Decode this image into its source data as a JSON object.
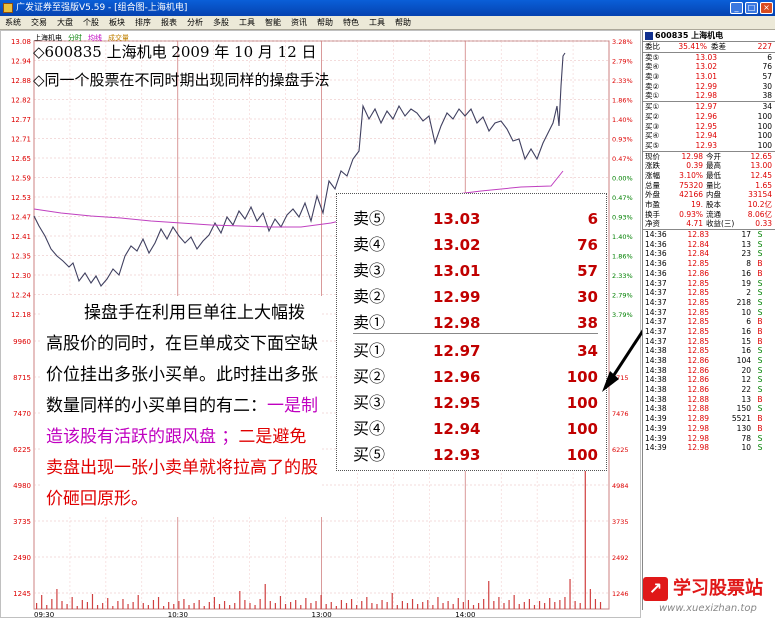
{
  "window": {
    "title": "广发证券至强版V5.59 - [组合图-上海机电]"
  },
  "menu": [
    "系统",
    "交易",
    "大盘",
    "个股",
    "板块",
    "排序",
    "报表",
    "分析",
    "多股",
    "工具",
    "智能",
    "资讯",
    "帮助",
    "特色",
    "工具",
    "帮助"
  ],
  "chart": {
    "tabs": [
      "上海机电",
      "分时",
      "均线",
      "成交量"
    ],
    "price_labels": [
      "13.08",
      "12.94",
      "12.88",
      "12.82",
      "12.77",
      "12.71",
      "12.65",
      "12.59",
      "12.53",
      "12.47",
      "12.41",
      "12.35",
      "12.30",
      "12.24",
      "12.18"
    ],
    "pct_labels": [
      "3.28%",
      "2.79%",
      "2.33%",
      "1.86%",
      "1.40%",
      "0.93%",
      "0.47%",
      "0.00%",
      "0.47%",
      "0.93%",
      "1.40%",
      "1.86%",
      "2.33%",
      "2.79%",
      "3.79%"
    ],
    "vol_labels": [
      "9960",
      "8715",
      "7470",
      "6225",
      "4980",
      "3735",
      "2490",
      "1245"
    ],
    "vol_labels_right": [
      "8715",
      "7476",
      "6225",
      "4984",
      "3735",
      "2492",
      "1246"
    ],
    "time_labels": [
      "09:30",
      "10:30",
      "13:00",
      "14:00"
    ]
  },
  "annotation": {
    "line1": "◇600835 上海机电 2009 年 10 月 12 日",
    "line2": "◇同一个股票在不同时期出现同样的操盘手法"
  },
  "note": {
    "part1": "操盘手在利用巨单往上大幅拨高股价的同时，在巨单成交下面空缺价位挂出多张小买单。此时挂出多张数量同样的小买单目的有二：",
    "part2": "一是制造该股有活跃的跟风盘 ；",
    "part3": "二是避免卖盘出现一张小卖单就将拉高了的股价砸回原形。"
  },
  "orderbook": {
    "sells": [
      {
        "label": "卖⑤",
        "price": "13.03",
        "vol": "6"
      },
      {
        "label": "卖④",
        "price": "13.02",
        "vol": "76"
      },
      {
        "label": "卖③",
        "price": "13.01",
        "vol": "57"
      },
      {
        "label": "卖②",
        "price": "12.99",
        "vol": "30"
      },
      {
        "label": "卖①",
        "price": "12.98",
        "vol": "38"
      }
    ],
    "buys": [
      {
        "label": "买①",
        "price": "12.97",
        "vol": "34"
      },
      {
        "label": "买②",
        "price": "12.96",
        "vol": "100"
      },
      {
        "label": "买③",
        "price": "12.95",
        "vol": "100"
      },
      {
        "label": "买④",
        "price": "12.94",
        "vol": "100"
      },
      {
        "label": "买⑤",
        "price": "12.93",
        "vol": "100"
      }
    ]
  },
  "panel": {
    "header": "600835 上海机电",
    "ratio": {
      "label": "委比",
      "value": "35.41%",
      "label2": "委差",
      "value2": "227"
    },
    "sells": [
      {
        "label": "卖⑤",
        "price": "13.03",
        "vol": "6"
      },
      {
        "label": "卖④",
        "price": "13.02",
        "vol": "76"
      },
      {
        "label": "卖③",
        "price": "13.01",
        "vol": "57"
      },
      {
        "label": "卖②",
        "price": "12.99",
        "vol": "30"
      },
      {
        "label": "卖①",
        "price": "12.98",
        "vol": "38"
      }
    ],
    "buys": [
      {
        "label": "买①",
        "price": "12.97",
        "vol": "34"
      },
      {
        "label": "买②",
        "price": "12.96",
        "vol": "100"
      },
      {
        "label": "买③",
        "price": "12.95",
        "vol": "100"
      },
      {
        "label": "买④",
        "price": "12.94",
        "vol": "100"
      },
      {
        "label": "买⑤",
        "price": "12.93",
        "vol": "100"
      }
    ],
    "stats": [
      [
        "现价",
        "12.98",
        "今开",
        "12.65"
      ],
      [
        "涨跌",
        "0.39",
        "最高",
        "13.00"
      ],
      [
        "涨幅",
        "3.10%",
        "最低",
        "12.45"
      ],
      [
        "总量",
        "75320",
        "量比",
        "1.65"
      ],
      [
        "外盘",
        "42166",
        "内盘",
        "33154"
      ],
      [
        "市盈",
        "19.",
        "股本",
        "10.2亿"
      ],
      [
        "换手",
        "0.93%",
        "流通",
        "8.06亿"
      ],
      [
        "净资",
        "4.71",
        "收益(三)",
        "0.33"
      ]
    ],
    "ticks": [
      [
        "14:36",
        "12.83",
        "17",
        "S"
      ],
      [
        "14:36",
        "12.84",
        "13",
        "S"
      ],
      [
        "14:36",
        "12.84",
        "23",
        "S"
      ],
      [
        "14:36",
        "12.85",
        "8",
        "B"
      ],
      [
        "14:36",
        "12.86",
        "16",
        "B"
      ],
      [
        "14:37",
        "12.85",
        "19",
        "S"
      ],
      [
        "14:37",
        "12.85",
        "2",
        "S"
      ],
      [
        "14:37",
        "12.85",
        "218",
        "S"
      ],
      [
        "14:37",
        "12.85",
        "10",
        "S"
      ],
      [
        "14:37",
        "12.85",
        "6",
        "B"
      ],
      [
        "14:37",
        "12.85",
        "16",
        "B"
      ],
      [
        "14:37",
        "12.85",
        "15",
        "B"
      ],
      [
        "14:38",
        "12.85",
        "16",
        "S"
      ],
      [
        "14:38",
        "12.86",
        "104",
        "S"
      ],
      [
        "14:38",
        "12.86",
        "20",
        "S"
      ],
      [
        "14:38",
        "12.86",
        "12",
        "S"
      ],
      [
        "14:38",
        "12.86",
        "22",
        "S"
      ],
      [
        "14:38",
        "12.88",
        "13",
        "B"
      ],
      [
        "14:38",
        "12.88",
        "150",
        "S"
      ],
      [
        "14:39",
        "12.89",
        "5521",
        "B"
      ],
      [
        "14:39",
        "12.98",
        "130",
        "B"
      ],
      [
        "14:39",
        "12.98",
        "78",
        "S"
      ],
      [
        "14:39",
        "12.98",
        "10",
        "S"
      ]
    ]
  },
  "logo": {
    "name": "学习股票站",
    "url": "www.xuexizhan.top"
  }
}
